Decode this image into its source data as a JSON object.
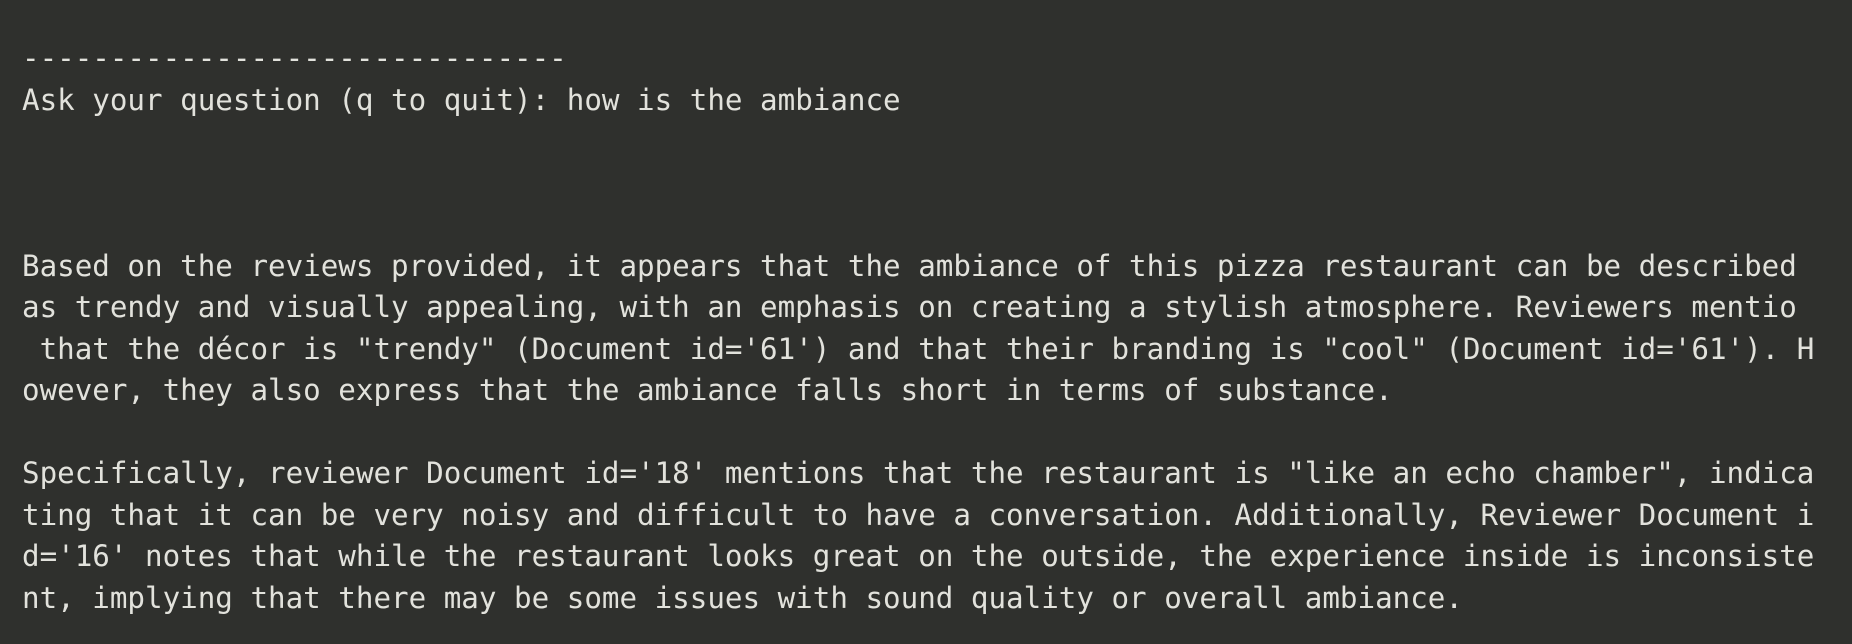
{
  "terminal": {
    "separator": "-------------------------------",
    "prompt": {
      "text": "Ask your question (q to quit): ",
      "input": "how is the ambiance"
    },
    "answer": {
      "paragraph1": [
        "Based on the reviews provided, it appears that the ambiance of this pizza restaurant can be described",
        "as trendy and visually appealing, with an emphasis on creating a stylish atmosphere. Reviewers mentio",
        " that the décor is \"trendy\" (Document id='61') and that their branding is \"cool\" (Document id='61'). H",
        "owever, they also express that the ambiance falls short in terms of substance."
      ],
      "paragraph2": [
        "Specifically, reviewer Document id='18' mentions that the restaurant is \"like an echo chamber\", indica",
        "ting that it can be very noisy and difficult to have a conversation. Additionally, Reviewer Document i",
        "d='16' notes that while the restaurant looks great on the outside, the experience inside is inconsiste",
        "nt, implying that there may be some issues with sound quality or overall ambiance."
      ]
    }
  }
}
